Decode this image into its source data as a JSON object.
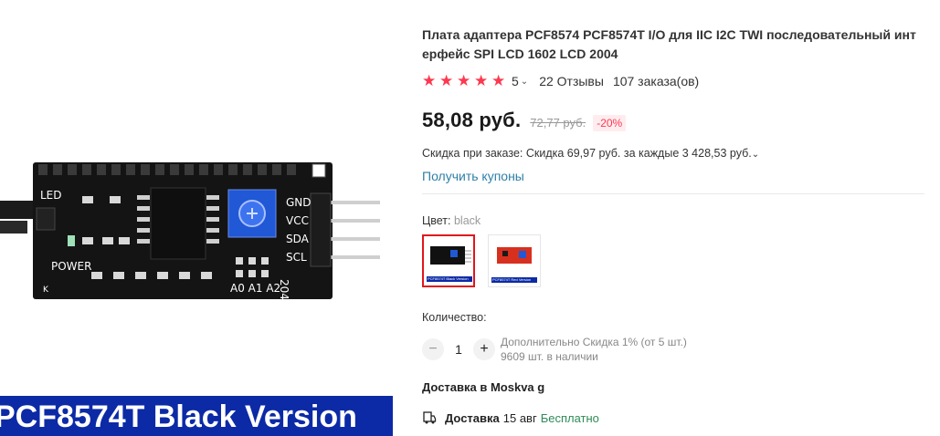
{
  "product": {
    "title": "Плата адаптера PCF8574 PCF8574T I/O для IIC I2C TWI последовательный интерфейс SPI LCD 1602 LCD 2004",
    "image_banner": "PCF8574T Black Version",
    "board_labels": {
      "led": "LED",
      "power": "POWER",
      "k": "K",
      "pins": [
        "GND",
        "VCC",
        "SDA",
        "SCL"
      ],
      "addr": "A0 A1 A2",
      "chip": "204"
    }
  },
  "rating": {
    "stars": 5,
    "value": "5",
    "reviews": "22 Отзывы",
    "orders": "107 заказа(ов)"
  },
  "pricing": {
    "price": "58,08 руб.",
    "old_price": "72,77 руб.",
    "discount": "-20%",
    "promo": "Скидка при заказе: Скидка 69,97 руб. за каждые 3 428,53 руб.",
    "coupons": "Получить купоны"
  },
  "variant": {
    "label": "Цвет:",
    "selected": "black",
    "options": [
      {
        "caption": "PCF8574T Black Version",
        "color": "#111111"
      },
      {
        "caption": "PCF8574T Red Version",
        "color": "#d8301e"
      }
    ]
  },
  "quantity": {
    "label": "Количество:",
    "minus": "−",
    "plus": "+",
    "value": "1",
    "note_discount": "Дополнительно Скидка 1% (от 5 шт.)",
    "note_stock": "9609 шт. в наличии"
  },
  "delivery": {
    "to": "Доставка в Moskva g",
    "label": "Доставка",
    "date": "15 авг",
    "price": "Бесплатно"
  },
  "icons": {
    "star": "star-icon",
    "chevron": "chevron-down-icon",
    "truck": "delivery-icon"
  },
  "colors": {
    "accent": "#fd384f",
    "link": "#2e7fa8",
    "free": "#2e8b57",
    "banner": "#0c2aa6"
  }
}
